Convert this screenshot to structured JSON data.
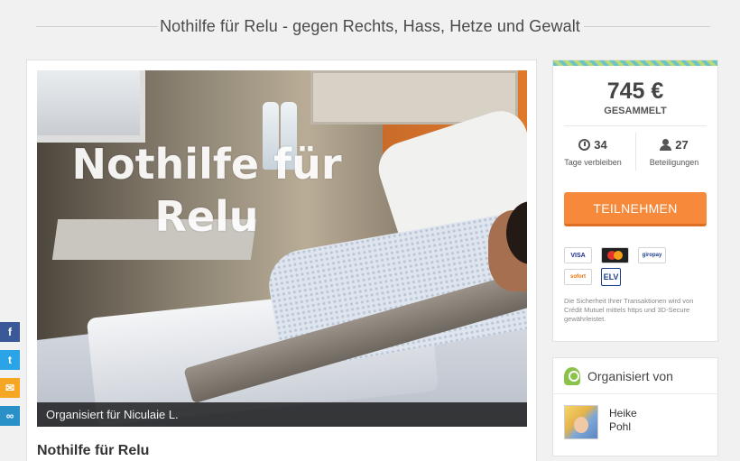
{
  "header": {
    "title": "Nothilfe für Relu - gegen Rechts, Hass, Hetze und Gewalt"
  },
  "hero": {
    "overlay_title": "Nothilfe für Relu",
    "caption": "Organisiert für Niculaie L."
  },
  "campaign": {
    "title": "Nothilfe für Relu"
  },
  "sidebar": {
    "amount": "745 €",
    "amount_label": "GESAMMELT",
    "days_left": "34",
    "days_left_label": "Tage verbleiben",
    "participants": "27",
    "participants_label": "Beteiligungen",
    "join_button": "TEILNEHMEN",
    "payment_methods": [
      "VISA",
      "MasterCard",
      "giropay",
      "sofort",
      "ELV"
    ],
    "security_note": "Die Sicherheit Ihrer Transaktionen wird von Crédit Mutuel mittels https und 3D-Secure gewährleistet."
  },
  "organizer": {
    "heading": "Organisiert von",
    "first_name": "Heike",
    "last_name": "Pohl"
  },
  "social": {
    "facebook_icon": "f",
    "twitter_icon": "t",
    "mail_icon": "✉",
    "link_icon": "∞"
  },
  "colors": {
    "accent": "#f7893b",
    "facebook": "#3b5998",
    "twitter": "#2aa4e6",
    "mail": "#f5a623",
    "link": "#2a90c8",
    "organizer_badge": "#8bc34a"
  }
}
